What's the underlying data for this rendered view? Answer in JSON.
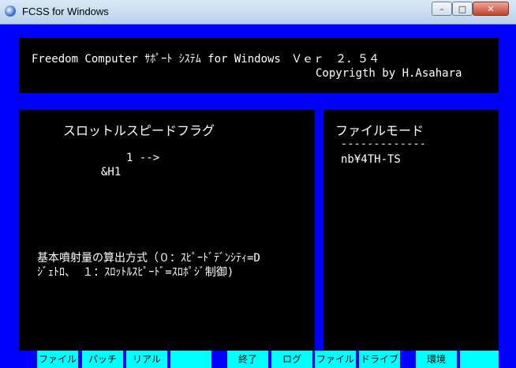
{
  "window": {
    "title": "FCSS for Windows",
    "minimize_glyph": "–",
    "maximize_glyph": "□",
    "close_glyph": "✕",
    "icon": "app-icon"
  },
  "header": {
    "product_line": "Freedom Computer ｻﾎﾟｰﾄ ｼｽﾃﾑ for Windows",
    "version_line": "Ｖｅｒ　２．５４",
    "copyright": "Copyrigth by H.Asahara"
  },
  "left_panel": {
    "heading": "スロットルスピードフラグ",
    "value_line": "1 -->",
    "hex_value": "&H1",
    "method_line1": "基本噴射量の算出方式（０：ｽﾋﾟｰﾄﾞﾃﾞﾝｼﾃｨ=D",
    "method_line2": "ｼﾞｪﾄﾛ、 １：ｽﾛｯﾄﾙｽﾋﾟｰﾄﾞ=ｽﾛﾎﾟｼﾞ制御)"
  },
  "right_panel": {
    "heading": "ファイルモード",
    "separator": "-------------",
    "filename": "nb¥4TH-TS"
  },
  "function_keys": [
    "ファイル",
    "パッチ",
    "リアル",
    "",
    "終了",
    "ログ",
    "ファイル名",
    "ドライブ",
    "環境",
    ""
  ],
  "colors": {
    "background": "#0000ff",
    "panel": "#000000",
    "text": "#ffffff",
    "function_key": "#00ffff"
  }
}
